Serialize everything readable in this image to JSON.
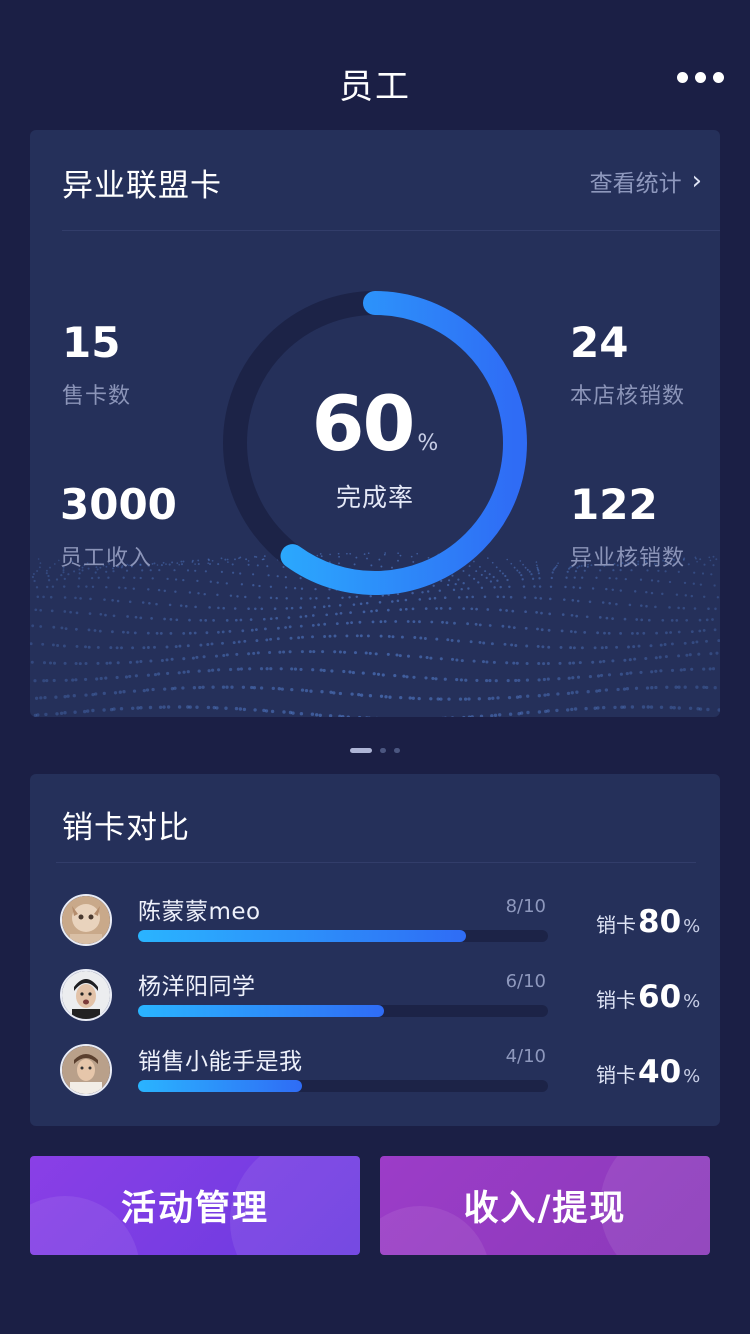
{
  "header": {
    "title": "员工"
  },
  "stats_card": {
    "title": "异业联盟卡",
    "view_stats_label": "查看统计",
    "stats": {
      "sold_cards": {
        "value": "15",
        "label": "售卡数"
      },
      "employee_income": {
        "value": "3000",
        "label": "员工收入"
      },
      "store_redeemed": {
        "value": "24",
        "label": "本店核销数"
      },
      "alliance_redeemed": {
        "value": "122",
        "label": "异业核销数"
      }
    },
    "completion": {
      "value": "60",
      "unit": "%",
      "label": "完成率",
      "fraction": 0.6
    }
  },
  "pager": {
    "count": 3,
    "active_index": 0
  },
  "compare_card": {
    "title": "销卡对比",
    "rows": [
      {
        "name": "陈蒙蒙meo",
        "fraction": "8/10",
        "ratio": 0.8,
        "prefix": "销卡",
        "percent": "80",
        "unit": "%"
      },
      {
        "name": "杨洋阳同学",
        "fraction": "6/10",
        "ratio": 0.6,
        "prefix": "销卡",
        "percent": "60",
        "unit": "%"
      },
      {
        "name": "销售小能手是我",
        "fraction": "4/10",
        "ratio": 0.4,
        "prefix": "销卡",
        "percent": "40",
        "unit": "%"
      }
    ]
  },
  "buttons": {
    "activity": "活动管理",
    "income": "收入/提现"
  },
  "colors": {
    "background": "#1b1f45",
    "card": "#25305a",
    "ring_track": "#1c2347",
    "ring_start": "#2ab4ff",
    "ring_end": "#2f6cf5",
    "activity_button": "#7a3de6",
    "income_button": "#933bc1"
  }
}
